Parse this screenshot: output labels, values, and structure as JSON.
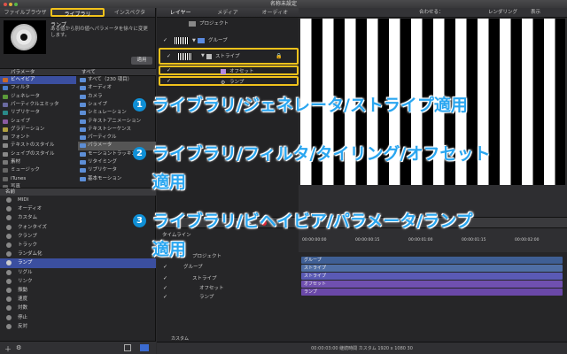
{
  "window": {
    "title": "名称未設定"
  },
  "left_tabs": [
    {
      "label": "ファイルブラウザ"
    },
    {
      "label": "ライブラリ"
    },
    {
      "label": "インスペクタ"
    }
  ],
  "preview": {
    "title": "ランプ",
    "description": "ある値から別の値へパラメータを徐々に変更します。",
    "apply": "適用"
  },
  "browser_header": {
    "col1": "パラメータ",
    "col2": "すべて"
  },
  "categories": [
    {
      "label": "ビヘイビア",
      "color": "#c86a2a"
    },
    {
      "label": "フィルタ",
      "color": "#4a7fd0"
    },
    {
      "label": "ジェネレータ",
      "color": "#5b9a3a"
    },
    {
      "label": "パーティクルエミッタ",
      "color": "#6a6aa0"
    },
    {
      "label": "リプリケータ",
      "color": "#2a8a8a"
    },
    {
      "label": "シェイプ",
      "color": "#8a5aa0"
    },
    {
      "label": "グラデーション",
      "color": "#b0a040"
    },
    {
      "label": "フォント",
      "color": "#888888"
    },
    {
      "label": "テキストのスタイル",
      "color": "#888888"
    },
    {
      "label": "シェイプのスタイル",
      "color": "#888888"
    },
    {
      "label": "素材",
      "color": "#777777"
    },
    {
      "label": "ミュージック",
      "color": "#666666"
    },
    {
      "label": "iTunes",
      "color": "#666666"
    },
    {
      "label": "写真",
      "color": "#666666"
    }
  ],
  "subcategories": [
    {
      "label": "すべて（230 項目）"
    },
    {
      "label": "オーディオ"
    },
    {
      "label": "カメラ"
    },
    {
      "label": "シェイプ"
    },
    {
      "label": "シミュレーション"
    },
    {
      "label": "テキストアニメーション"
    },
    {
      "label": "テキストシーケンス"
    },
    {
      "label": "パーティクル"
    },
    {
      "label": "パラメータ"
    },
    {
      "label": "モーショントラッキング"
    },
    {
      "label": "リタイミング"
    },
    {
      "label": "リプリケータ"
    },
    {
      "label": "基本モーション"
    }
  ],
  "params_header": {
    "label": "名前"
  },
  "params": [
    {
      "label": "MIDI"
    },
    {
      "label": "オーディオ"
    },
    {
      "label": "カスタム"
    },
    {
      "label": "クォンタイズ"
    },
    {
      "label": "クランプ"
    },
    {
      "label": "トラック"
    },
    {
      "label": "ランダム化"
    },
    {
      "label": "ランプ"
    },
    {
      "label": "リグル"
    },
    {
      "label": "リンク"
    },
    {
      "label": "振動"
    },
    {
      "label": "速度"
    },
    {
      "label": "対数"
    },
    {
      "label": "停止"
    },
    {
      "label": "反対"
    }
  ],
  "mid_tabs": [
    {
      "label": "レイヤー"
    },
    {
      "label": "メディア"
    },
    {
      "label": "オーディオ"
    }
  ],
  "layers": [
    {
      "label": "プロジェクト"
    },
    {
      "label": "グループ"
    },
    {
      "label": "ストライプ"
    },
    {
      "label": "オフセット"
    },
    {
      "label": "ランプ"
    }
  ],
  "canvas_bar": {
    "fit": "合わせる：",
    "render": "レンダリング",
    "view": "表示"
  },
  "timeline": {
    "label": "タイムライン",
    "rows": [
      {
        "label": "プロジェクト"
      },
      {
        "label": "グループ"
      },
      {
        "label": "ストライプ"
      },
      {
        "label": "オフセット"
      },
      {
        "label": "ランプ"
      }
    ],
    "tracks": [
      {
        "label": "グループ",
        "color": "#3f5f95"
      },
      {
        "label": "ストライプ",
        "color": "#4f6ea5"
      },
      {
        "label": "ストライプ",
        "color": "#5a5ab5"
      },
      {
        "label": "オフセット",
        "color": "#7050b0"
      },
      {
        "label": "ランプ",
        "color": "#6a48a8"
      }
    ],
    "ticks": [
      "00:00:00:00",
      "00:00:00:15",
      "00:00:01:00",
      "00:00:01:15",
      "00:00:02:00"
    ]
  },
  "status": {
    "text": "00:00:03:00  継続時間  カスタム  1920 x 1080  30"
  },
  "left_footer": {
    "custom": "カスタム"
  },
  "callouts": [
    {
      "num": "1",
      "text": "ライブラリ/ジェネレータ/ストライプ適用"
    },
    {
      "num": "2",
      "line1": "ライブラリ/フィルタ/タイリング/オフセット",
      "line2": "適用"
    },
    {
      "num": "3",
      "line1": "ライブラリ/ビヘイビア/パラメータ/ランプ",
      "line2": "適用"
    }
  ]
}
